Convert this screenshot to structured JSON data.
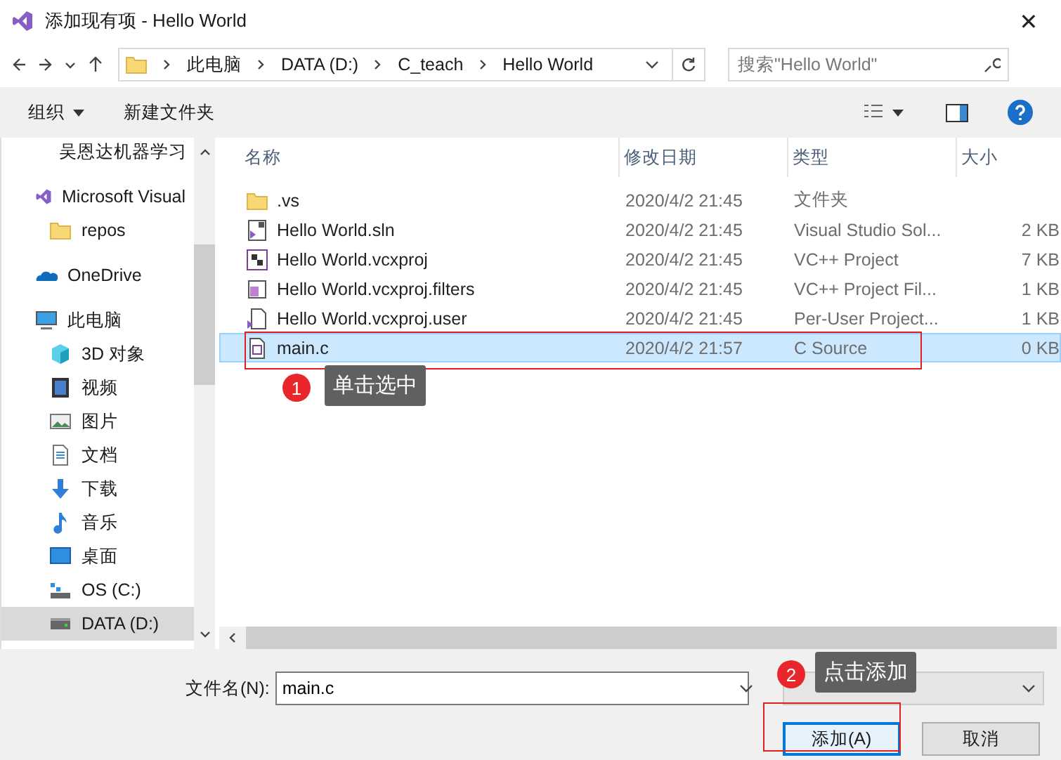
{
  "window": {
    "title": "添加现有项 - Hello World",
    "close": "✕"
  },
  "nav": {
    "breadcrumb": [
      "此电脑",
      "DATA (D:)",
      "C_teach",
      "Hello World"
    ],
    "search": {
      "placeholder": "搜索\"Hello World\""
    }
  },
  "toolbar": {
    "organize": "组织",
    "new_folder": "新建文件夹"
  },
  "sidebar": {
    "items": [
      {
        "label": "吴恩达机器学习",
        "kind": "folder",
        "selected": false
      },
      {
        "label": "Microsoft Visual",
        "kind": "vs",
        "selected": false
      },
      {
        "label": "repos",
        "kind": "folder",
        "selected": false
      },
      {
        "label": "OneDrive",
        "kind": "cloud",
        "selected": false
      },
      {
        "label": "此电脑",
        "kind": "pc",
        "selected": false
      },
      {
        "label": "3D 对象",
        "kind": "cube",
        "selected": false
      },
      {
        "label": "视频",
        "kind": "video",
        "selected": false
      },
      {
        "label": "图片",
        "kind": "image",
        "selected": false
      },
      {
        "label": "文档",
        "kind": "doc",
        "selected": false
      },
      {
        "label": "下载",
        "kind": "download",
        "selected": false
      },
      {
        "label": "音乐",
        "kind": "music",
        "selected": false
      },
      {
        "label": "桌面",
        "kind": "desktop",
        "selected": false
      },
      {
        "label": "OS (C:)",
        "kind": "os-drive",
        "selected": false
      },
      {
        "label": "DATA (D:)",
        "kind": "drive",
        "selected": true
      }
    ]
  },
  "table": {
    "columns": [
      "名称",
      "修改日期",
      "类型",
      "大小"
    ],
    "rows": [
      {
        "name": ".vs",
        "kind": "folder",
        "date": "2020/4/2 21:45",
        "type": "文件夹",
        "size": "",
        "selected": false
      },
      {
        "name": "Hello World.sln",
        "kind": "sln",
        "date": "2020/4/2 21:45",
        "type": "Visual Studio Sol...",
        "size": "2 KB",
        "selected": false
      },
      {
        "name": "Hello World.vcxproj",
        "kind": "proj",
        "date": "2020/4/2 21:45",
        "type": "VC++ Project",
        "size": "7 KB",
        "selected": false
      },
      {
        "name": "Hello World.vcxproj.filters",
        "kind": "filters",
        "date": "2020/4/2 21:45",
        "type": "VC++ Project Fil...",
        "size": "1 KB",
        "selected": false
      },
      {
        "name": "Hello World.vcxproj.user",
        "kind": "user",
        "date": "2020/4/2 21:45",
        "type": "Per-User Project...",
        "size": "1 KB",
        "selected": false
      },
      {
        "name": "main.c",
        "kind": "c",
        "date": "2020/4/2 21:57",
        "type": "C Source",
        "size": "0 KB",
        "selected": true
      }
    ]
  },
  "footer": {
    "filename_label": "文件名(N):",
    "filename": "main.c",
    "add": "添加(A)",
    "cancel": "取消"
  },
  "annotations": [
    {
      "number": "1",
      "text": "单击选中"
    },
    {
      "number": "2",
      "text": "点击添加"
    }
  ]
}
